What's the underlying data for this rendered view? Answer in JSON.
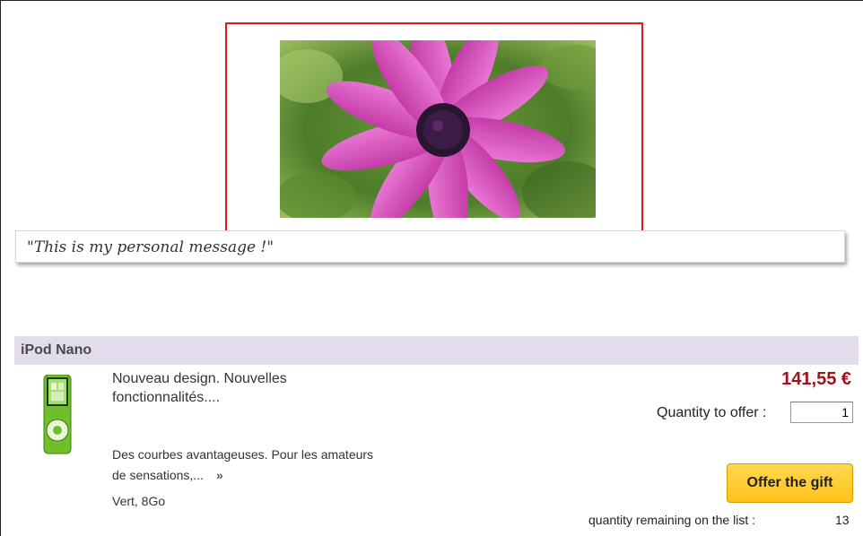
{
  "gift": {
    "photo_subject": "pink daisy flower",
    "personal_message": "\"This is my personal message !\""
  },
  "product": {
    "name": "iPod Nano",
    "short_description": "Nouveau design. Nouvelles fonctionnalités....",
    "long_description": "Des courbes avantageuses. Pour les amateurs de sensations,...",
    "more_icon": "double-chevron-right-icon",
    "more_glyph": "»",
    "variant": "Vert, 8Go",
    "price": "141,55 €",
    "quantity_label": "Quantity to offer :",
    "quantity_value": "1",
    "offer_button": "Offer the gift",
    "remaining_label": "quantity remaining on the list :",
    "remaining_value": "13"
  },
  "colors": {
    "photo_border": "#e11919",
    "header_bg": "#e2dcec",
    "price": "#a3111c",
    "button": "#ffc21a"
  }
}
